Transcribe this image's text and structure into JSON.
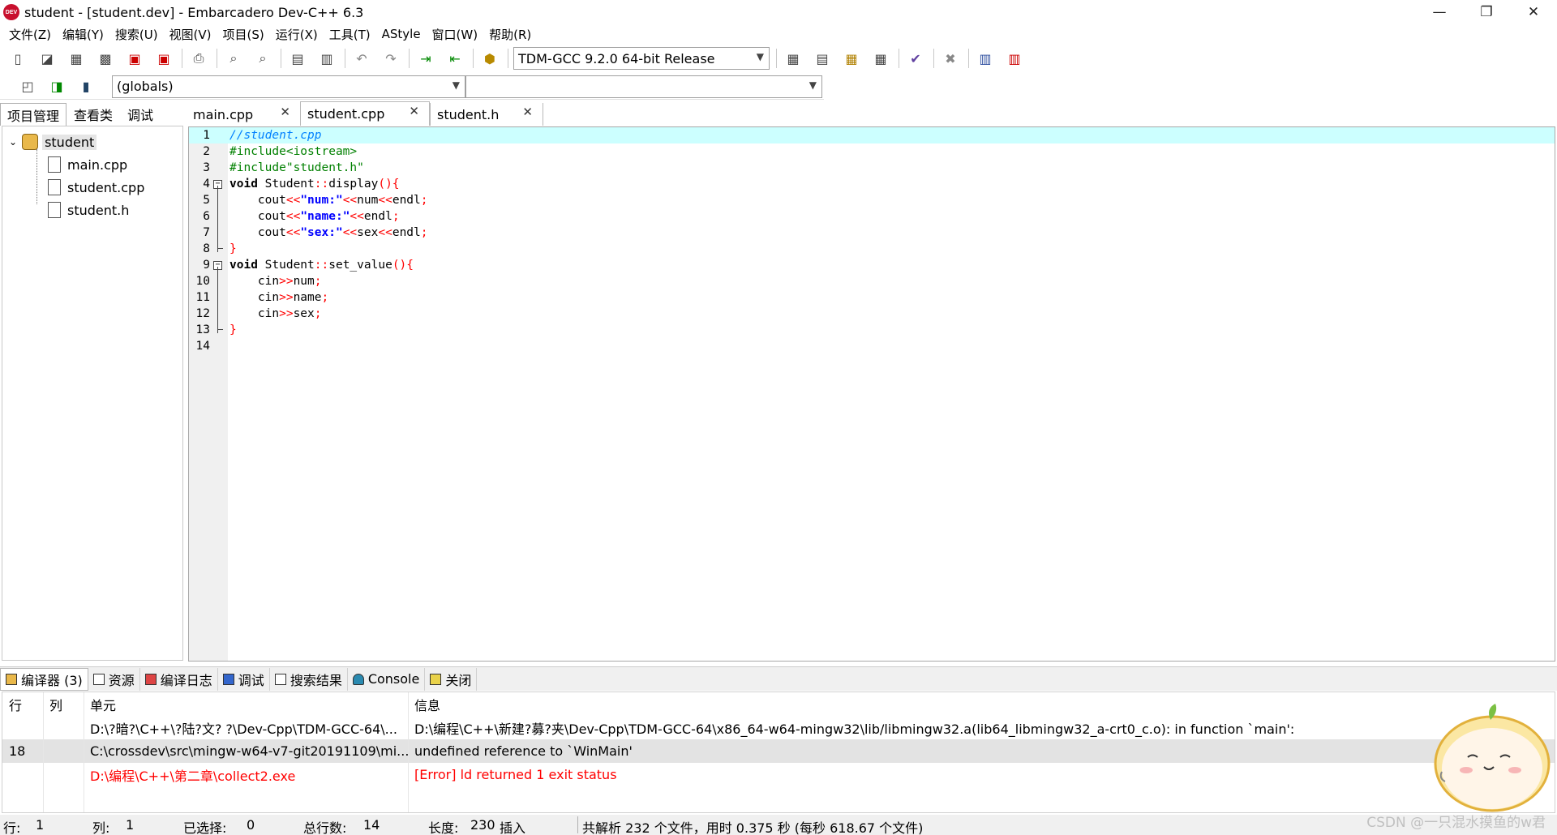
{
  "window": {
    "title": "student - [student.dev] - Embarcadero Dev-C++ 6.3",
    "icon_label": "DEV",
    "controls": {
      "minimize": "—",
      "maximize": "❐",
      "close": "✕"
    }
  },
  "menu": [
    "文件(Z)",
    "编辑(Y)",
    "搜索(U)",
    "视图(V)",
    "项目(S)",
    "运行(X)",
    "工具(T)",
    "AStyle",
    "窗口(W)",
    "帮助(R)"
  ],
  "toolbar": {
    "compiler_select": "TDM-GCC 9.2.0 64-bit Release",
    "scope_select": "(globals)",
    "function_select": ""
  },
  "left_tabs": [
    "项目管理",
    "查看类",
    "调试"
  ],
  "project": {
    "name": "student",
    "files": [
      "main.cpp",
      "student.cpp",
      "student.h"
    ]
  },
  "editor_tabs": [
    {
      "label": "main.cpp",
      "close": "✕"
    },
    {
      "label": "student.cpp",
      "close": "✕"
    },
    {
      "label": "student.h",
      "close": "✕"
    }
  ],
  "code_lines": [
    {
      "n": "1",
      "parts": [
        [
          "cm",
          "//student.cpp"
        ]
      ]
    },
    {
      "n": "2",
      "parts": [
        [
          "pp",
          "#include<iostream>"
        ]
      ]
    },
    {
      "n": "3",
      "parts": [
        [
          "pp",
          "#include\"student.h\""
        ]
      ]
    },
    {
      "n": "4",
      "parts": [
        [
          "kw",
          "void "
        ],
        [
          "plain",
          "Student"
        ],
        [
          "sym",
          "::"
        ],
        [
          "plain",
          "display"
        ],
        [
          "sym",
          "(){"
        ]
      ]
    },
    {
      "n": "5",
      "parts": [
        [
          "plain",
          "    cout"
        ],
        [
          "sym",
          "<<"
        ],
        [
          "str",
          "\"num:\""
        ],
        [
          "sym",
          "<<"
        ],
        [
          "plain",
          "num"
        ],
        [
          "sym",
          "<<"
        ],
        [
          "plain",
          "endl"
        ],
        [
          "sym",
          ";"
        ]
      ]
    },
    {
      "n": "6",
      "parts": [
        [
          "plain",
          "    cout"
        ],
        [
          "sym",
          "<<"
        ],
        [
          "str",
          "\"name:\""
        ],
        [
          "sym",
          "<<"
        ],
        [
          "plain",
          "endl"
        ],
        [
          "sym",
          ";"
        ]
      ]
    },
    {
      "n": "7",
      "parts": [
        [
          "plain",
          "    cout"
        ],
        [
          "sym",
          "<<"
        ],
        [
          "str",
          "\"sex:\""
        ],
        [
          "sym",
          "<<"
        ],
        [
          "plain",
          "sex"
        ],
        [
          "sym",
          "<<"
        ],
        [
          "plain",
          "endl"
        ],
        [
          "sym",
          ";"
        ]
      ]
    },
    {
      "n": "8",
      "parts": [
        [
          "sym",
          "}"
        ]
      ]
    },
    {
      "n": "9",
      "parts": [
        [
          "kw",
          "void "
        ],
        [
          "plain",
          "Student"
        ],
        [
          "sym",
          "::"
        ],
        [
          "plain",
          "set_value"
        ],
        [
          "sym",
          "(){"
        ]
      ]
    },
    {
      "n": "10",
      "parts": [
        [
          "plain",
          "    cin"
        ],
        [
          "sym",
          ">>"
        ],
        [
          "plain",
          "num"
        ],
        [
          "sym",
          ";"
        ]
      ]
    },
    {
      "n": "11",
      "parts": [
        [
          "plain",
          "    cin"
        ],
        [
          "sym",
          ">>"
        ],
        [
          "plain",
          "name"
        ],
        [
          "sym",
          ";"
        ]
      ]
    },
    {
      "n": "12",
      "parts": [
        [
          "plain",
          "    cin"
        ],
        [
          "sym",
          ">>"
        ],
        [
          "plain",
          "sex"
        ],
        [
          "sym",
          ";"
        ]
      ]
    },
    {
      "n": "13",
      "parts": [
        [
          "sym",
          "}"
        ]
      ]
    },
    {
      "n": "14",
      "parts": []
    }
  ],
  "bottom_tabs": [
    "编译器 (3)",
    "资源",
    "编译日志",
    "调试",
    "搜索结果",
    "Console",
    "关闭"
  ],
  "messages": {
    "headers": {
      "row": "行",
      "col": "列",
      "unit": "单元",
      "info": "信息"
    },
    "rows": [
      {
        "row": "",
        "col": "",
        "unit": "D:\\?暗?\\C++\\?陆?文?   ?\\Dev-Cpp\\TDM-GCC-64\\...",
        "info": "D:\\编程\\C++\\新建?募?夹\\Dev-Cpp\\TDM-GCC-64\\x86_64-w64-mingw32\\lib/libmingw32.a(lib64_libmingw32_a-crt0_c.o): in function `main':"
      },
      {
        "row": "18",
        "col": "",
        "unit": "C:\\crossdev\\src\\mingw-w64-v7-git20191109\\mi...",
        "info": "undefined reference to `WinMain'"
      },
      {
        "row": "",
        "col": "",
        "unit": "D:\\编程\\C++\\第二章\\collect2.exe",
        "info": "[Error] ld returned 1 exit status"
      }
    ]
  },
  "status": {
    "line_label": "行:",
    "line_value": "1",
    "col_label": "列:",
    "col_value": "1",
    "sel_label": "已选择:",
    "sel_value": "0",
    "total_label": "总行数:",
    "total_value": "14",
    "len_label": "长度:",
    "len_value": "230",
    "mode": "插入",
    "parse_info": "共解析 232 个文件，用时 0.375 秒 (每秒 618.67 个文件)"
  },
  "watermark": "CSDN @一只混水摸鱼的w君",
  "colors": {
    "highlight_line": "#ccffff",
    "comment": "#0080ff",
    "preprocessor": "#008000",
    "symbol": "#ff0000",
    "string": "#0000ff",
    "error_text": "#ff0000"
  }
}
